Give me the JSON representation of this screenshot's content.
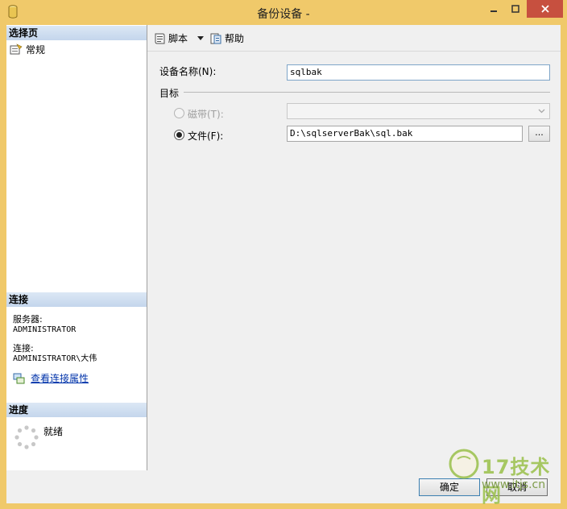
{
  "window": {
    "title": "备份设备 -"
  },
  "sidebar": {
    "select_page_header": "选择页",
    "nav_items": [
      {
        "label": "常规",
        "icon": "general-page-icon"
      }
    ],
    "connection_header": "连接",
    "server_label": "服务器:",
    "server_value": "ADMINISTRATOR",
    "connection_label": "连接:",
    "connection_value": "ADMINISTRATOR\\大伟",
    "view_connection_link": "查看连接属性",
    "progress_header": "进度",
    "progress_status": "就绪"
  },
  "toolbar": {
    "script_label": "脚本",
    "help_label": "帮助"
  },
  "form": {
    "device_name_label": "设备名称(N):",
    "device_name_value": "sqlbak",
    "target_group_label": "目标",
    "tape_label": "磁带(T):",
    "tape_value": "",
    "file_label": "文件(F):",
    "file_value": "D:\\sqlserverBak\\sql.bak",
    "browse_label": "...",
    "selected_target": "file"
  },
  "buttons": {
    "ok_label": "确定",
    "cancel_label": "取消"
  },
  "watermark": {
    "text": "17技术网",
    "url": "www.itjs.cn"
  },
  "colors": {
    "window_frame": "#f0c96a",
    "close_button": "#c7503f",
    "section_header": "#c4d6ec",
    "link": "#0033aa"
  }
}
